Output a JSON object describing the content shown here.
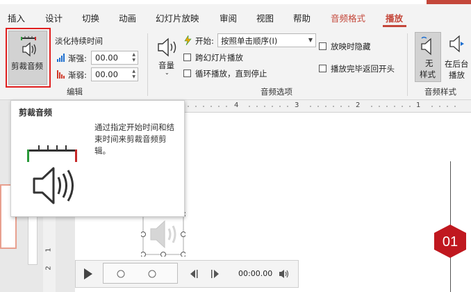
{
  "tabs": [
    {
      "label": "插入",
      "context": false,
      "active": false
    },
    {
      "label": "设计",
      "context": false,
      "active": false
    },
    {
      "label": "切换",
      "context": false,
      "active": false
    },
    {
      "label": "动画",
      "context": false,
      "active": false
    },
    {
      "label": "幻灯片放映",
      "context": false,
      "active": false
    },
    {
      "label": "审阅",
      "context": false,
      "active": false
    },
    {
      "label": "视图",
      "context": false,
      "active": false
    },
    {
      "label": "帮助",
      "context": false,
      "active": false
    },
    {
      "label": "音频格式",
      "context": true,
      "active": false
    },
    {
      "label": "播放",
      "context": true,
      "active": true
    }
  ],
  "ribbon": {
    "trim_audio_label": "剪裁音频",
    "fade_duration_label": "淡化持续时间",
    "fade_in_label": "渐强:",
    "fade_in_value": "00.00",
    "fade_out_label": "渐弱:",
    "fade_out_value": "00.00",
    "edit_group_label": "编辑",
    "volume_label": "音量",
    "start_label": "开始:",
    "start_value": "按照单击顺序(I)",
    "play_across_slides": "跨幻灯片播放",
    "loop_until_stopped": "循环播放，直到停止",
    "hide_during_show": "放映时隐藏",
    "rewind_after_playing": "播放完毕返回开头",
    "audio_options_group_label": "音频选项",
    "no_style_line1": "无",
    "no_style_line2": "样式",
    "play_in_bg_line1": "在后台",
    "play_in_bg_line2": "播放",
    "audio_styles_group_label": "音频样式"
  },
  "ruler": {
    "ticks": [
      "4",
      "3",
      "2",
      "1"
    ]
  },
  "vruler": {
    "ticks": [
      "1",
      "2"
    ]
  },
  "tooltip": {
    "title": "剪裁音频",
    "description": "通过指定开始时间和结束时间来剪裁音频剪辑。"
  },
  "slide": {
    "badge_number": "01"
  },
  "player": {
    "time": "00:00.00"
  },
  "colors": {
    "accent": "#c4473a",
    "highlight": "#e02020",
    "badge": "#c0181f"
  }
}
